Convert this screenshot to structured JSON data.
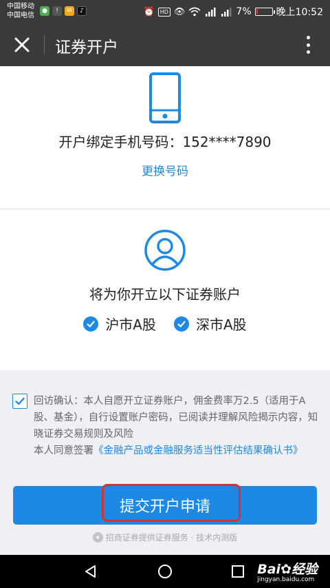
{
  "status_bar": {
    "carrier1": "中国移动",
    "carrier2": "中国电信",
    "signal1_label": "4G",
    "signal2_label": "2G",
    "battery_text": "7%",
    "battery_level": 0.07,
    "time": "晚上10:52",
    "hd_badge": "HD"
  },
  "app_bar": {
    "title": "证券开户"
  },
  "phone_card": {
    "bound_phone_label": "开户绑定手机号码：",
    "bound_phone_value": "152****7890",
    "change_number_label": "更换号码"
  },
  "account_card": {
    "title": "将为你开立以下证券账户",
    "markets": [
      {
        "label": "沪市A股",
        "checked": true
      },
      {
        "label": "深市A股",
        "checked": true
      }
    ]
  },
  "agreement": {
    "checked": true,
    "line1": "回访确认：本人自愿开立证券账户，佣金费率万2.5（适用于A股、基金），自行设置账户密码，已阅读并理解风险揭示内容，知晓证券交易规则及风险",
    "line2_prefix": "本人同意签署",
    "line2_link": "《金融产品或金融服务适当性评估结果确认书》"
  },
  "submit": {
    "label": "提交开户申请"
  },
  "footer": {
    "note": "招商证券提供证券服务 · 技术内测版"
  },
  "watermark": {
    "main": "Bai",
    "brand": "经验",
    "sub": "jingyan.baidu.com"
  },
  "colors": {
    "accent": "#1e88e5",
    "header": "#3a3a3a",
    "highlight": "#d9322e"
  }
}
